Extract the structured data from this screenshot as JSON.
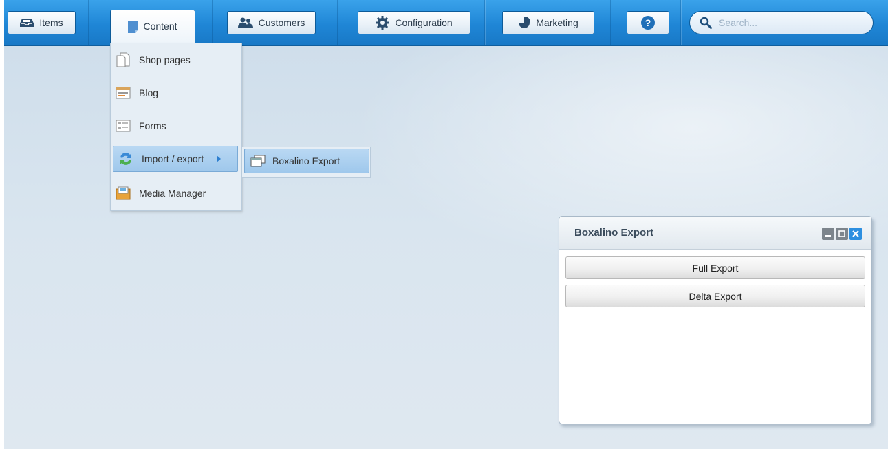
{
  "nav": {
    "items_label": "Items",
    "content_label": "Content",
    "customers_label": "Customers",
    "configuration_label": "Configuration",
    "marketing_label": "Marketing",
    "help_symbol": "?",
    "search_placeholder": "Search..."
  },
  "content_menu": {
    "items": [
      {
        "label": "Shop pages",
        "icon": "page-icon"
      },
      {
        "label": "Blog",
        "icon": "blog-icon"
      },
      {
        "label": "Forms",
        "icon": "form-icon"
      },
      {
        "label": "Import / export",
        "icon": "import-export-icon"
      },
      {
        "label": "Media Manager",
        "icon": "media-manager-icon"
      }
    ]
  },
  "submenu": {
    "label": "Boxalino Export",
    "icon": "windows-icon"
  },
  "window": {
    "title": "Boxalino Export",
    "full_export_label": "Full Export",
    "delta_export_label": "Delta Export"
  },
  "colors": {
    "menubar": "#1f86d6",
    "selected_item": "#9fc8ec",
    "close_button": "#2d8fe0"
  }
}
